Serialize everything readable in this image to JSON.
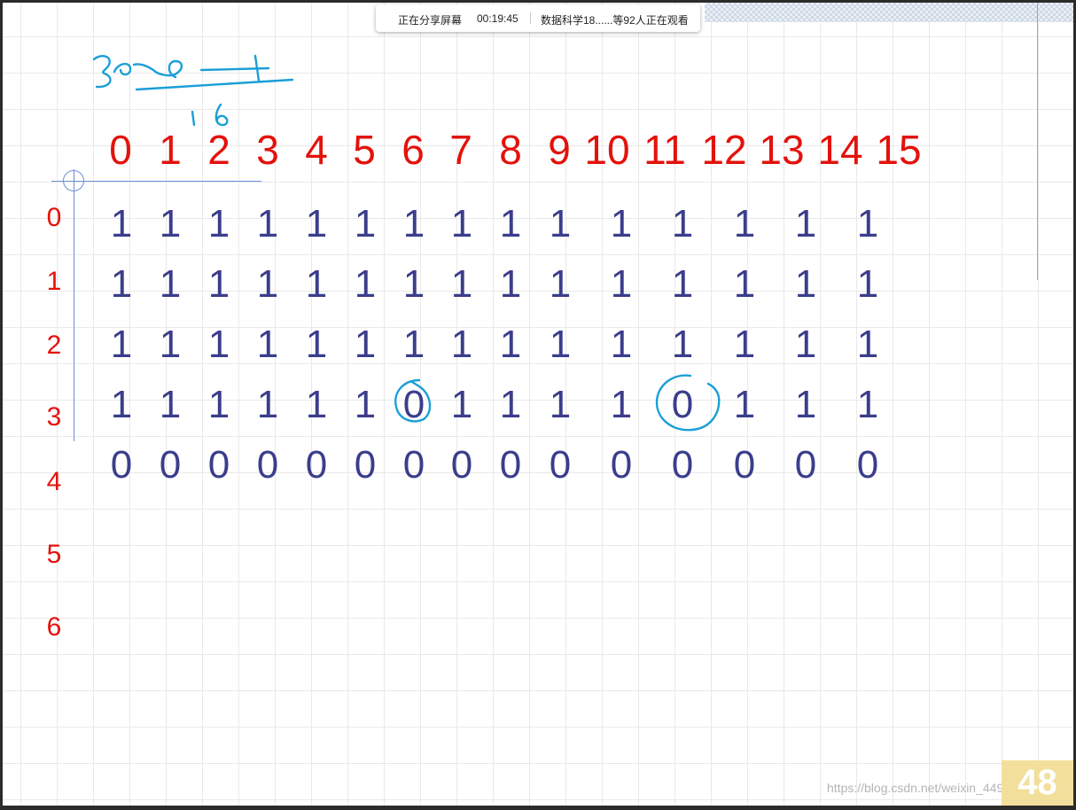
{
  "share_bar": {
    "status": "正在分享屏幕",
    "elapsed": "00:19:45",
    "viewers": "数据科学18......等92人正在观看"
  },
  "board": {
    "column_headers": [
      "0",
      "1",
      "2",
      "3",
      "4",
      "5",
      "6",
      "7",
      "8",
      "9",
      "10",
      "11",
      "12",
      "13",
      "14",
      "15"
    ],
    "row_headers": [
      "0",
      "1",
      "2",
      "3",
      "4",
      "5",
      "6"
    ],
    "rows": [
      [
        "1",
        "1",
        "1",
        "1",
        "1",
        "1",
        "1",
        "1",
        "1",
        "1",
        "1",
        "1",
        "1",
        "1",
        "1"
      ],
      [
        "1",
        "1",
        "1",
        "1",
        "1",
        "1",
        "1",
        "1",
        "1",
        "1",
        "1",
        "1",
        "1",
        "1",
        "1"
      ],
      [
        "1",
        "1",
        "1",
        "1",
        "1",
        "1",
        "1",
        "1",
        "1",
        "1",
        "1",
        "1",
        "1",
        "1",
        "1"
      ],
      [
        "1",
        "1",
        "1",
        "1",
        "1",
        "1",
        "0",
        "1",
        "1",
        "1",
        "1",
        "0",
        "1",
        "1",
        "1"
      ],
      [
        "0",
        "0",
        "0",
        "0",
        "0",
        "0",
        "0",
        "0",
        "0",
        "0",
        "0",
        "0",
        "0",
        "0",
        "0"
      ]
    ],
    "circled_cells": [
      "row 3, column 6",
      "row 3, column 11"
    ]
  },
  "page_number": "48",
  "watermark": "https://blog.csdn.net/weixin_44949135",
  "colors": {
    "header_red": "#e3120b",
    "cell_navy": "#3b3d8c",
    "ink_blue": "#1a9fd6",
    "axis_blue": "#6f8fd6",
    "page_badge": "#f2df9c"
  }
}
